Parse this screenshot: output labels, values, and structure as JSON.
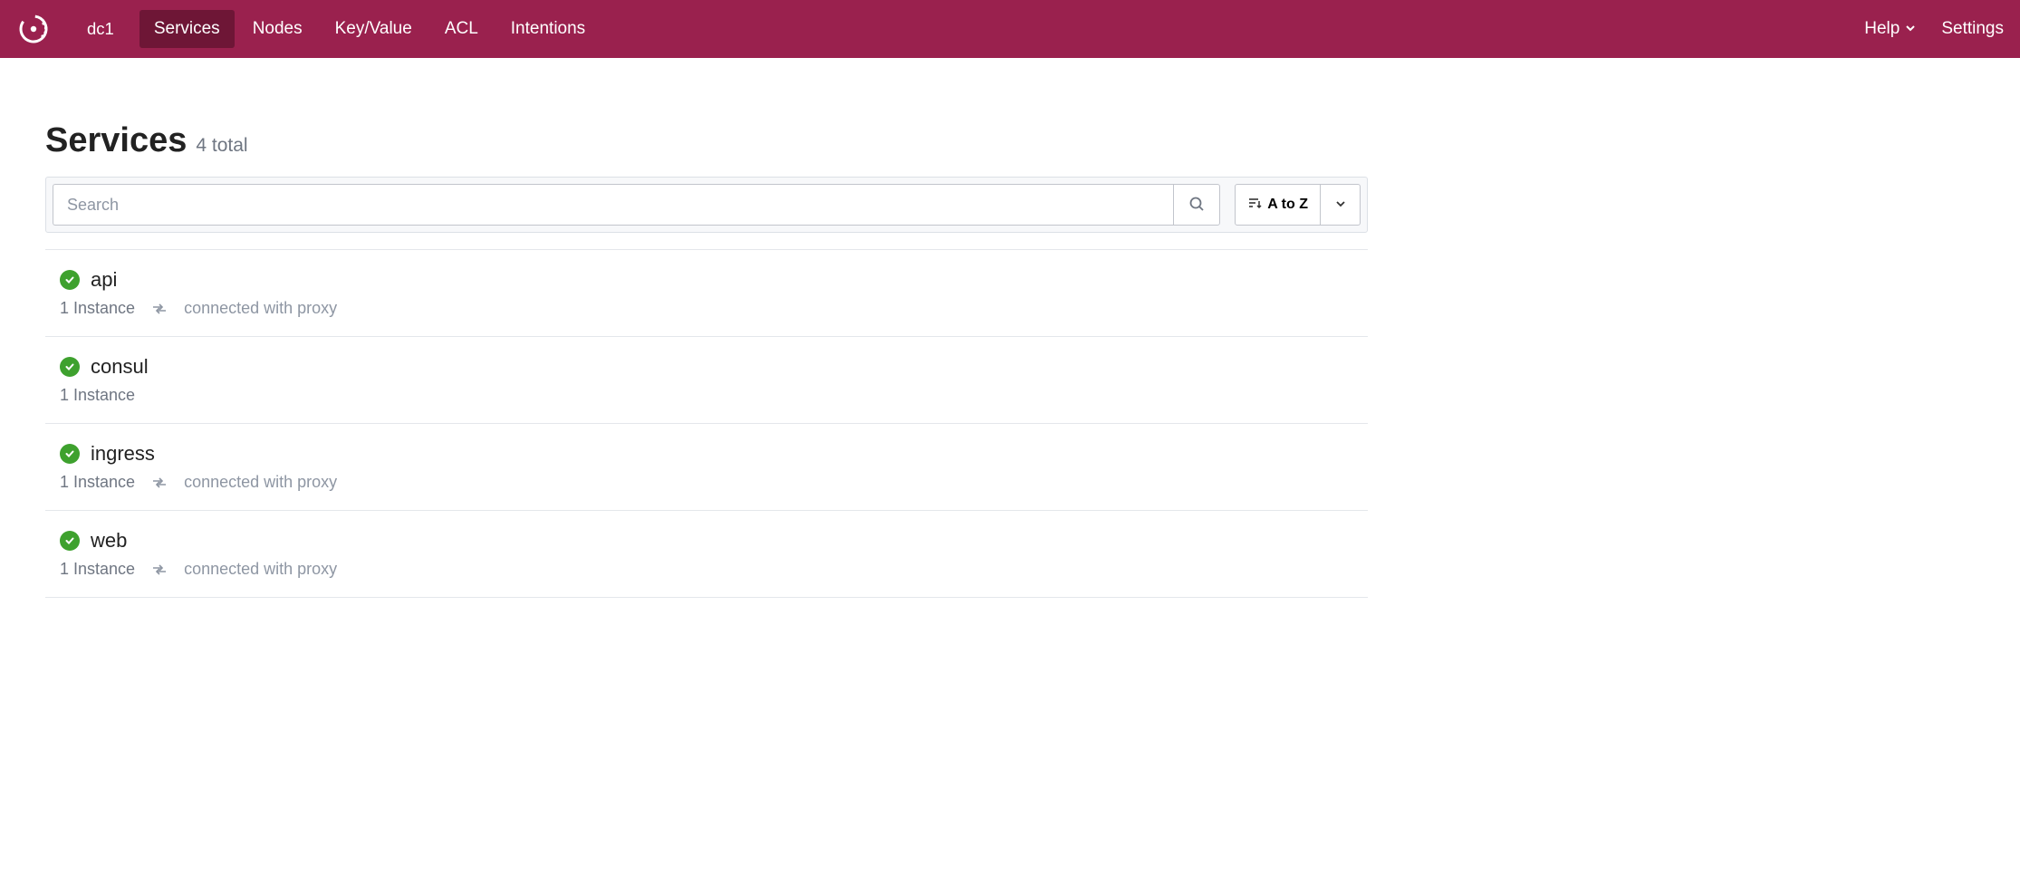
{
  "nav": {
    "datacenter": "dc1",
    "items": [
      {
        "label": "Services",
        "active": true
      },
      {
        "label": "Nodes",
        "active": false
      },
      {
        "label": "Key/Value",
        "active": false
      },
      {
        "label": "ACL",
        "active": false
      },
      {
        "label": "Intentions",
        "active": false
      }
    ],
    "help": "Help",
    "settings": "Settings"
  },
  "page": {
    "title": "Services",
    "total": "4 total"
  },
  "search": {
    "placeholder": "Search",
    "sort_label": "A to Z"
  },
  "services": [
    {
      "name": "api",
      "instances": "1 Instance",
      "proxy": "connected with proxy",
      "status": "passing"
    },
    {
      "name": "consul",
      "instances": "1 Instance",
      "proxy": null,
      "status": "passing"
    },
    {
      "name": "ingress",
      "instances": "1 Instance",
      "proxy": "connected with proxy",
      "status": "passing"
    },
    {
      "name": "web",
      "instances": "1 Instance",
      "proxy": "connected with proxy",
      "status": "passing"
    }
  ]
}
